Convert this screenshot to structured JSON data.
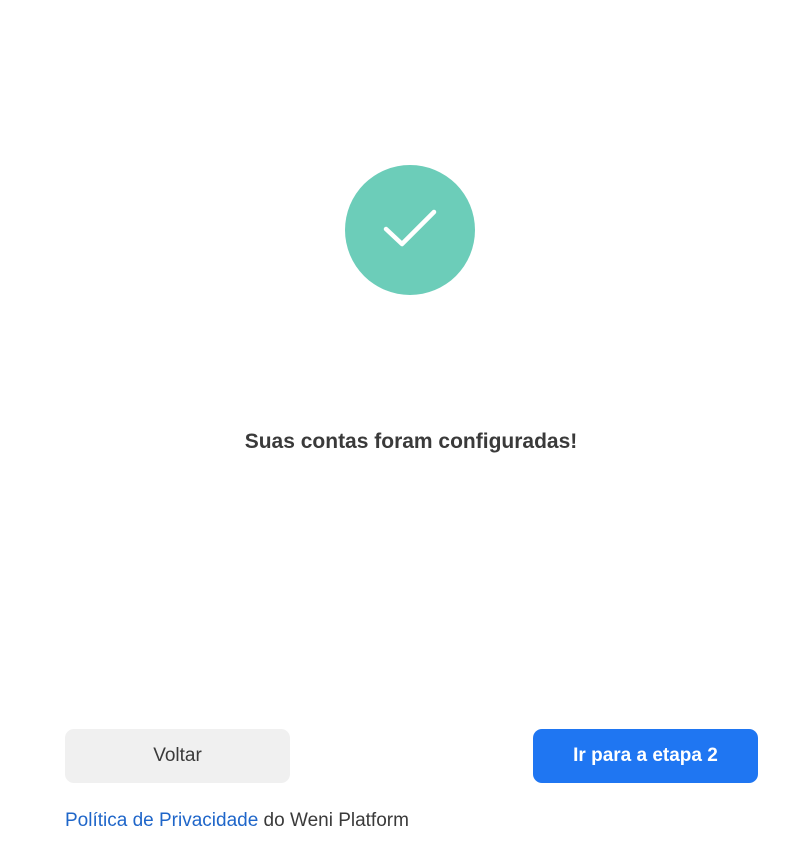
{
  "success": {
    "icon": "check-icon",
    "circle_color": "#6ccdb9",
    "message": "Suas contas foram configuradas!"
  },
  "actions": {
    "back_label": "Voltar",
    "next_label": "Ir para a etapa 2",
    "primary_color": "#1f76f2"
  },
  "footer": {
    "privacy_link": "Política de Privacidade",
    "suffix": " do Weni Platform"
  }
}
